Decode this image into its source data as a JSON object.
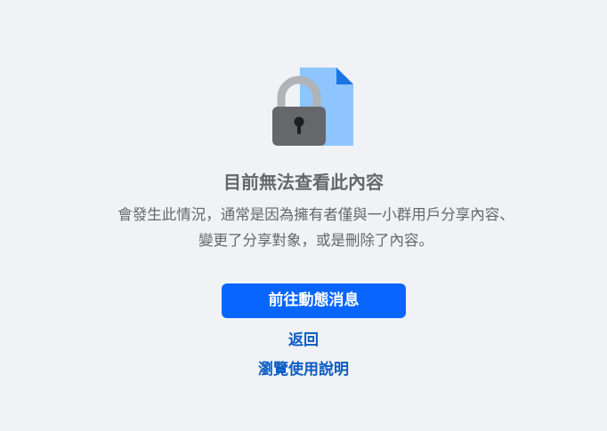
{
  "content_unavailable": {
    "title": "目前無法查看此內容",
    "description": "會發生此情況，通常是因為擁有者僅與一小群用戶分享內容、變更了分享對象，或是刪除了內容。",
    "primary_button_label": "前往動態消息",
    "back_link_label": "返回",
    "help_link_label": "瀏覽使用說明"
  },
  "icons": {
    "illustration": "locked-document-icon"
  },
  "colors": {
    "background": "#f0f2f5",
    "primary": "#0866ff",
    "link": "#0a5bc4",
    "text_secondary": "#65676b",
    "document_light": "#8ec5ff",
    "document_dark": "#1b74e4",
    "lock_body": "#65676b",
    "shackle": "#b0b3b8"
  }
}
